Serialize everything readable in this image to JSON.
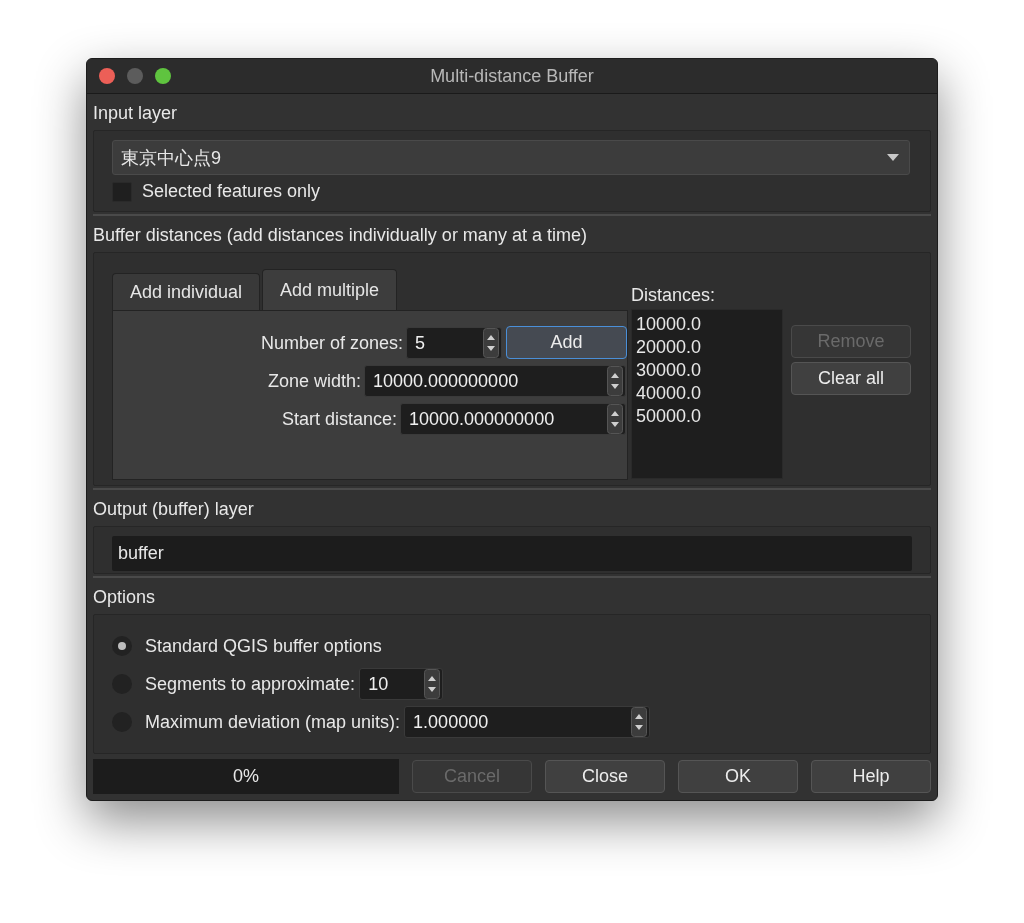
{
  "window": {
    "title": "Multi-distance Buffer"
  },
  "input_layer": {
    "heading": "Input layer",
    "layer": "東京中心点9",
    "selected_only": {
      "label": "Selected features only",
      "checked": false
    }
  },
  "buffer_distances": {
    "heading": "Buffer distances (add distances individually or many at a time)",
    "tabs": [
      {
        "label": "Add individual",
        "selected": false
      },
      {
        "label": "Add multiple",
        "selected": true
      }
    ],
    "fields": [
      {
        "label": "Number of zones:",
        "value": "5"
      },
      {
        "label": "Zone width:",
        "value": "10000.000000000"
      },
      {
        "label": "Start distance:",
        "value": "10000.000000000"
      }
    ],
    "add_button": "Add",
    "distances_label": "Distances:",
    "distances": [
      "10000.0",
      "20000.0",
      "30000.0",
      "40000.0",
      "50000.0"
    ],
    "buttons": [
      {
        "label": "Remove",
        "disabled": true
      },
      {
        "label": "Clear all",
        "disabled": false
      }
    ]
  },
  "output": {
    "heading": "Output (buffer) layer",
    "value": "buffer"
  },
  "options": {
    "heading": "Options",
    "items": [
      {
        "label": "Standard QGIS buffer options",
        "selected": true
      },
      {
        "label": "Segments to approximate:",
        "selected": false,
        "value": "10"
      },
      {
        "label": "Maximum deviation (map units):",
        "selected": false,
        "value": "1.000000"
      }
    ]
  },
  "footer": {
    "progress": {
      "level": 0,
      "reading": "0%"
    },
    "buttons": [
      {
        "label": "Cancel",
        "disabled": true
      },
      {
        "label": "Close",
        "disabled": false
      },
      {
        "label": "OK",
        "disabled": false
      },
      {
        "label": "Help",
        "disabled": false
      }
    ]
  }
}
